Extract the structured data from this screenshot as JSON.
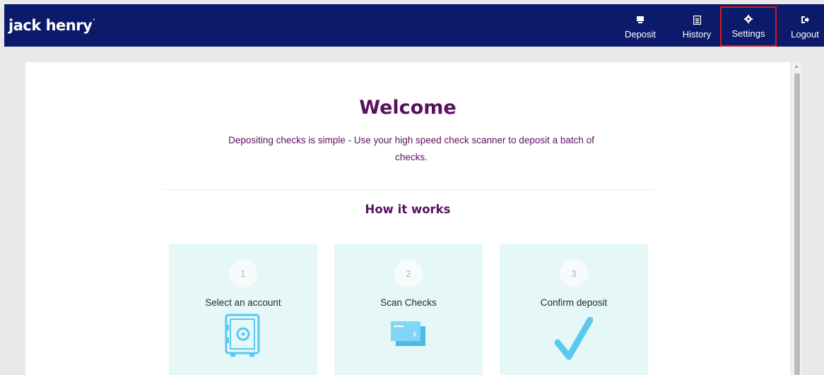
{
  "header": {
    "brand": "jack henry",
    "nav": [
      {
        "label": "Deposit",
        "icon": "deposit-icon"
      },
      {
        "label": "History",
        "icon": "history-icon"
      },
      {
        "label": "Settings",
        "icon": "gear-icon",
        "highlighted": true
      },
      {
        "label": "Logout",
        "icon": "logout-icon"
      }
    ]
  },
  "main": {
    "title": "Welcome",
    "subtitle": "Depositing checks is simple - Use your high speed check scanner to deposit a batch of checks.",
    "section_title": "How it works",
    "steps": [
      {
        "number": "1",
        "label": "Select an account",
        "icon": "safe-icon"
      },
      {
        "number": "2",
        "label": "Scan Checks",
        "icon": "checks-icon"
      },
      {
        "number": "3",
        "label": "Confirm deposit",
        "icon": "checkmark-icon"
      }
    ]
  },
  "colors": {
    "header_bg": "#0c1a6b",
    "accent_purple": "#5a1060",
    "card_bg": "#e6f7f8",
    "icon_blue": "#5bc8f0",
    "highlight_border": "#d11a1a"
  }
}
